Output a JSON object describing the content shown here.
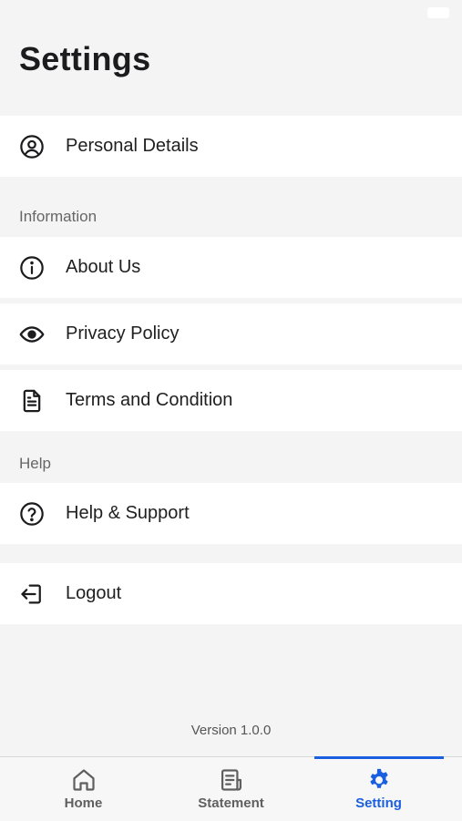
{
  "header": {
    "title": "Settings"
  },
  "account": {
    "personal_details": "Personal Details"
  },
  "information": {
    "section_label": "Information",
    "about_us": "About Us",
    "privacy_policy": "Privacy Policy",
    "terms": "Terms and Condition"
  },
  "help": {
    "section_label": "Help",
    "help_support": "Help & Support"
  },
  "session": {
    "logout": "Logout"
  },
  "footer": {
    "version": "Version 1.0.0"
  },
  "tabbar": {
    "home": "Home",
    "statement": "Statement",
    "setting": "Setting",
    "active": "Setting"
  },
  "colors": {
    "accent": "#1a5fe0",
    "background": "#f4f4f4",
    "row": "#ffffff",
    "muted": "#666666"
  },
  "icons": [
    "user-circle-icon",
    "info-icon",
    "eye-icon",
    "document-icon",
    "help-circle-icon",
    "logout-icon",
    "home-icon",
    "statement-icon",
    "gear-icon"
  ]
}
